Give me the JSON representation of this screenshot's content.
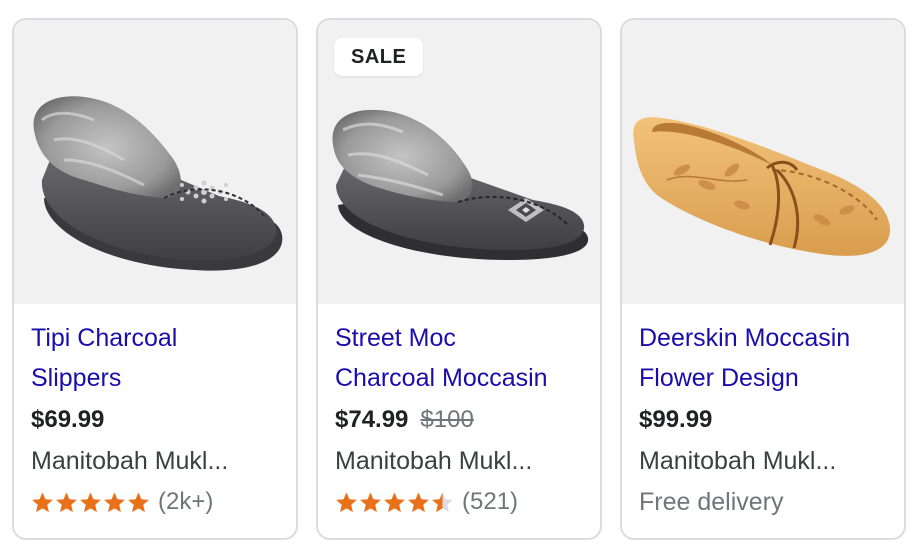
{
  "colors": {
    "title_link": "#1a0dab",
    "price": "#202124",
    "muted": "#70757a",
    "star": "#e8711a",
    "star_empty": "#dadce0",
    "card_border": "#dadce0"
  },
  "products": [
    {
      "title_line1": "Tipi Charcoal",
      "title_line2": "Slippers",
      "price": "$69.99",
      "merchant": "Manitobah Mukl...",
      "rating": 5,
      "review_count": "(2k+)",
      "image_icon": "gray-fur-moccasin-slipper"
    },
    {
      "badge": "SALE",
      "title_line1": "Street Moc",
      "title_line2": "Charcoal Moccasin",
      "price": "$74.99",
      "old_price": "$100",
      "merchant": "Manitobah Mukl...",
      "rating": 4.5,
      "review_count": "(521)",
      "image_icon": "gray-fur-moccasin"
    },
    {
      "title_line1": "Deerskin Moccasin",
      "title_line2": "Flower Design",
      "price": "$99.99",
      "merchant": "Manitobah Mukl...",
      "delivery": "Free delivery",
      "image_icon": "tan-deerskin-moccasin"
    }
  ]
}
